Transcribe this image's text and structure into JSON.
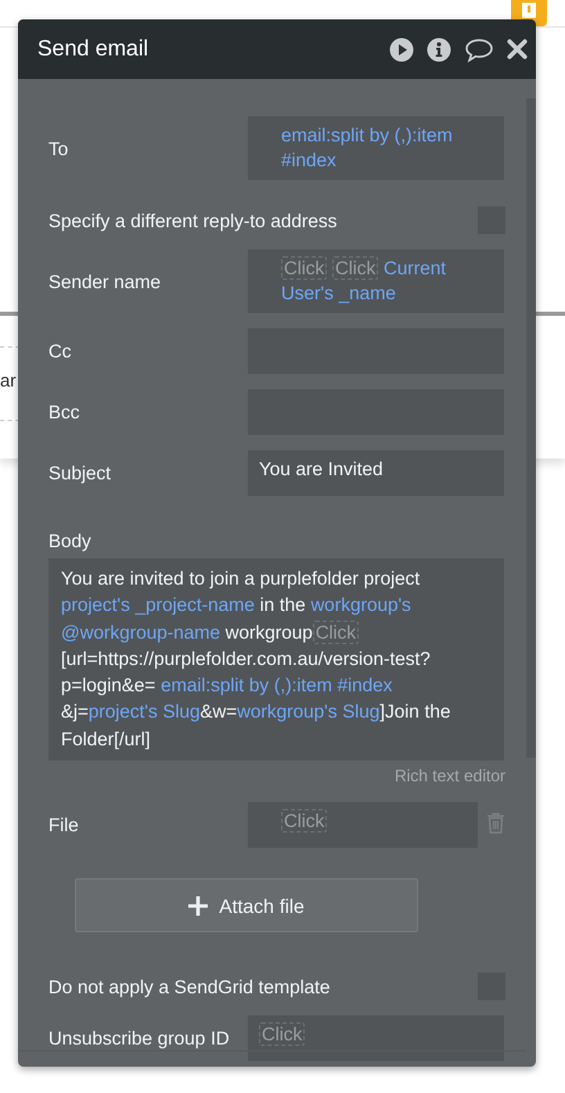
{
  "background": {
    "text": "ar"
  },
  "window": {
    "title": "Send email"
  },
  "rows": [
    {
      "kind": "field",
      "label": "To",
      "segments": [
        {
          "kind": "dynamic",
          "text": "email:split by (,):item #index"
        }
      ]
    },
    {
      "kind": "checkbox",
      "label": "Specify a different reply-to address",
      "checked": false
    },
    {
      "kind": "field",
      "label": "Sender name",
      "segments": [
        {
          "kind": "placeholder",
          "text": "Click"
        },
        {
          "kind": "placeholder",
          "text": "Click"
        },
        {
          "kind": "dynamic",
          "text": "Current User's _name"
        }
      ]
    },
    {
      "kind": "field",
      "label": "Cc",
      "segments": []
    },
    {
      "kind": "field",
      "label": "Bcc",
      "segments": []
    },
    {
      "kind": "field",
      "label": "Subject",
      "segments": [
        {
          "kind": "text",
          "text": "You are Invited"
        }
      ]
    },
    {
      "kind": "textarea",
      "label": "Body",
      "note": "Rich text editor",
      "segments": [
        {
          "kind": "text",
          "text": "You are invited to join a purplefolder project "
        },
        {
          "kind": "dynamic",
          "text": "project's _project-name"
        },
        {
          "kind": "text",
          "text": " in the "
        },
        {
          "kind": "dynamic",
          "text": "workgroup's @workgroup-name"
        },
        {
          "kind": "text",
          "text": " workgroup"
        },
        {
          "kind": "placeholder",
          "text": "Click"
        },
        {
          "kind": "text",
          "text": " [url=https://purplefolder.com.au/version-test?p=login&e= "
        },
        {
          "kind": "dynamic",
          "text": "email:split by (,):item #index"
        },
        {
          "kind": "text",
          "text": " &j="
        },
        {
          "kind": "dynamic",
          "text": "project's Slug"
        },
        {
          "kind": "text",
          "text": "&w="
        },
        {
          "kind": "dynamic",
          "text": "workgroup's Slug"
        },
        {
          "kind": "text",
          "text": "]Join the Folder[/url]"
        }
      ]
    },
    {
      "kind": "file",
      "label": "File",
      "segments": [
        {
          "kind": "placeholder",
          "text": "Click"
        }
      ]
    },
    {
      "kind": "button",
      "label": "Attach file"
    },
    {
      "kind": "checkbox",
      "label": "Do not apply a SendGrid template",
      "checked": false
    },
    {
      "kind": "field",
      "label": "Unsubscribe group ID",
      "segments": [
        {
          "kind": "placeholder",
          "text": "Click"
        }
      ]
    }
  ]
}
